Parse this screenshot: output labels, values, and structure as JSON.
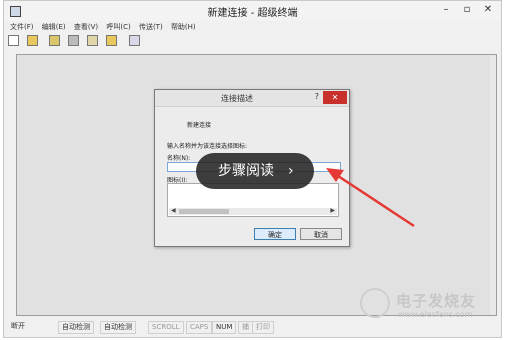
{
  "window": {
    "title": "新建连接 - 超级终端",
    "minimize": "–",
    "maximize": "▫",
    "close": "✕"
  },
  "menu": [
    "文件(F)",
    "编辑(E)",
    "查看(V)",
    "呼叫(C)",
    "传送(T)",
    "帮助(H)"
  ],
  "toolbar": [
    "new-icon",
    "open-icon",
    "connect-icon",
    "disconnect-icon",
    "send-icon",
    "receive-icon",
    "properties-icon"
  ],
  "status": {
    "state": "断开",
    "detect1": "自动检测",
    "detect2": "自动检测",
    "scroll": "SCROLL",
    "caps": "CAPS",
    "num": "NUM",
    "capture": "捕",
    "print": "打印"
  },
  "dialog": {
    "title": "连接描述",
    "help": "?",
    "close": "✕",
    "heading": "新建连接",
    "prompt": "输入名称并为该连接选择图标:",
    "name_label": "名称(N):",
    "name_value": "",
    "icon_label": "图标(I):",
    "ok": "确定",
    "cancel": "取消"
  },
  "overlay": {
    "text": "步骤阅读",
    "chevron": "›"
  },
  "watermark": {
    "text": "电子发烧友",
    "url": "www.elecfans.com"
  },
  "colors": {
    "arrow": "#e53935",
    "dialog_close": "#c9302c",
    "overlay_bg": "#202020"
  }
}
